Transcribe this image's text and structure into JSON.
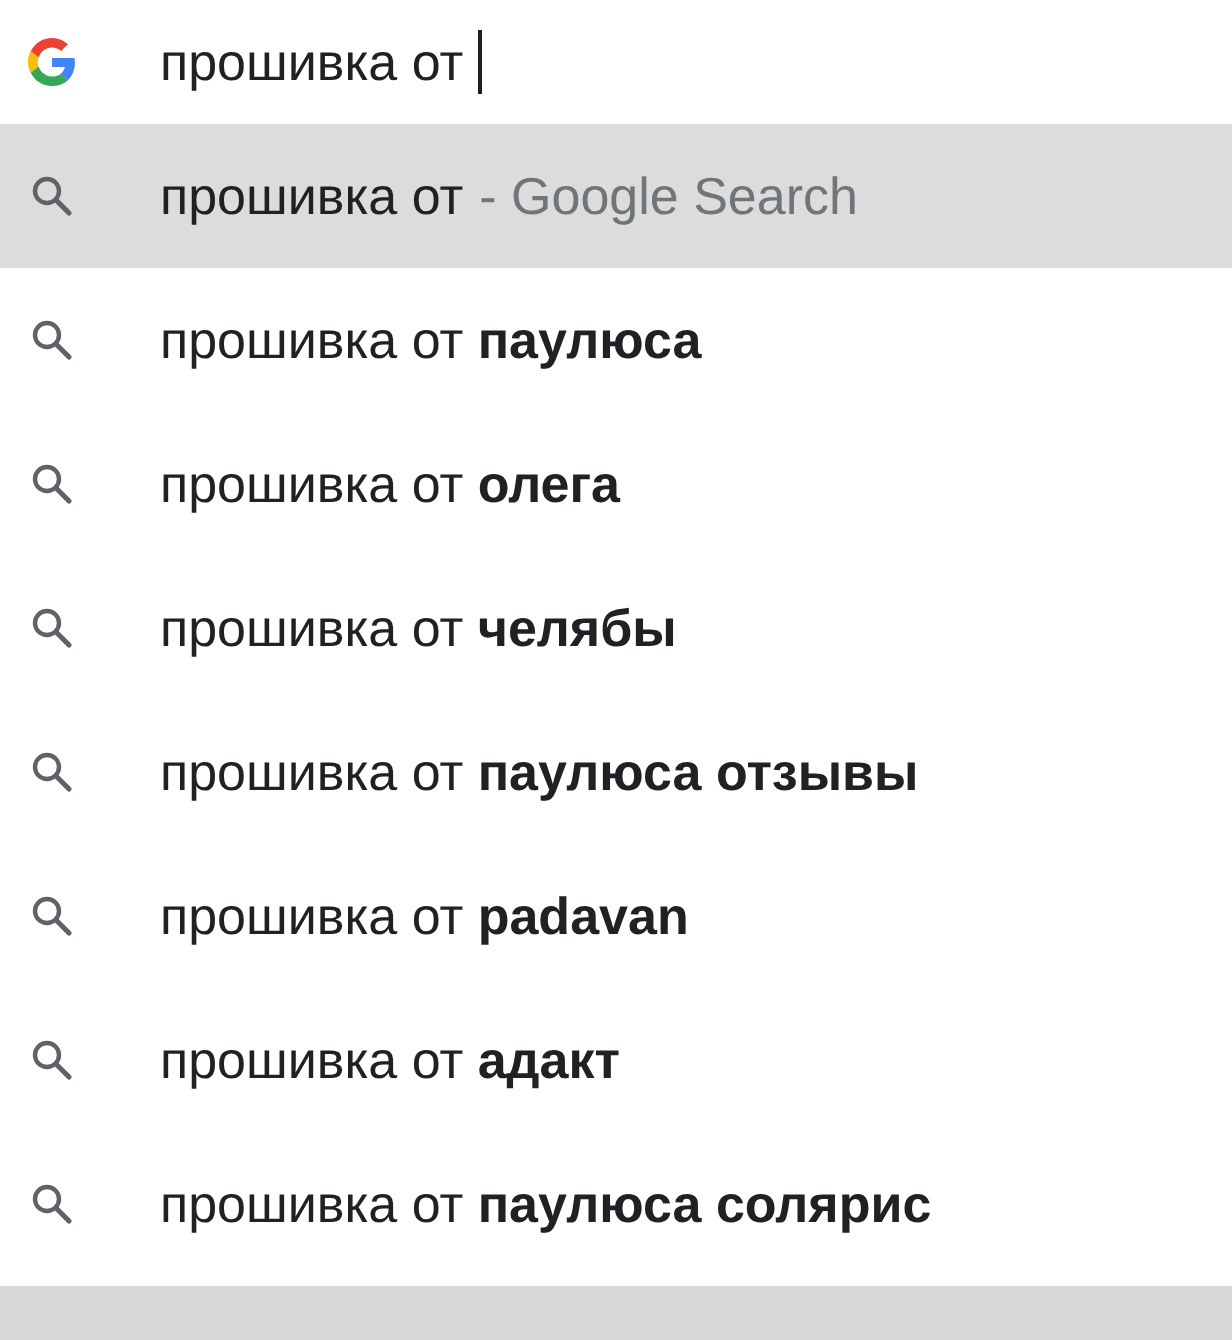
{
  "search": {
    "value": "прошивка от "
  },
  "suggestions": [
    {
      "text": "прошивка от",
      "suffix": "- Google Search",
      "selected": true
    },
    {
      "text": "прошивка от **паулюса**",
      "selected": false
    },
    {
      "text": "прошивка от **олега**",
      "selected": false
    },
    {
      "text": "прошивка от **челябы**",
      "selected": false
    },
    {
      "text": "прошивка от **паулюса отзывы**",
      "selected": false
    },
    {
      "text": "прошивка от **padavan**",
      "selected": false
    },
    {
      "text": "прошивка от **адакт**",
      "selected": false
    },
    {
      "text": "прошивка от **паулюса солярис**",
      "selected": false
    }
  ]
}
